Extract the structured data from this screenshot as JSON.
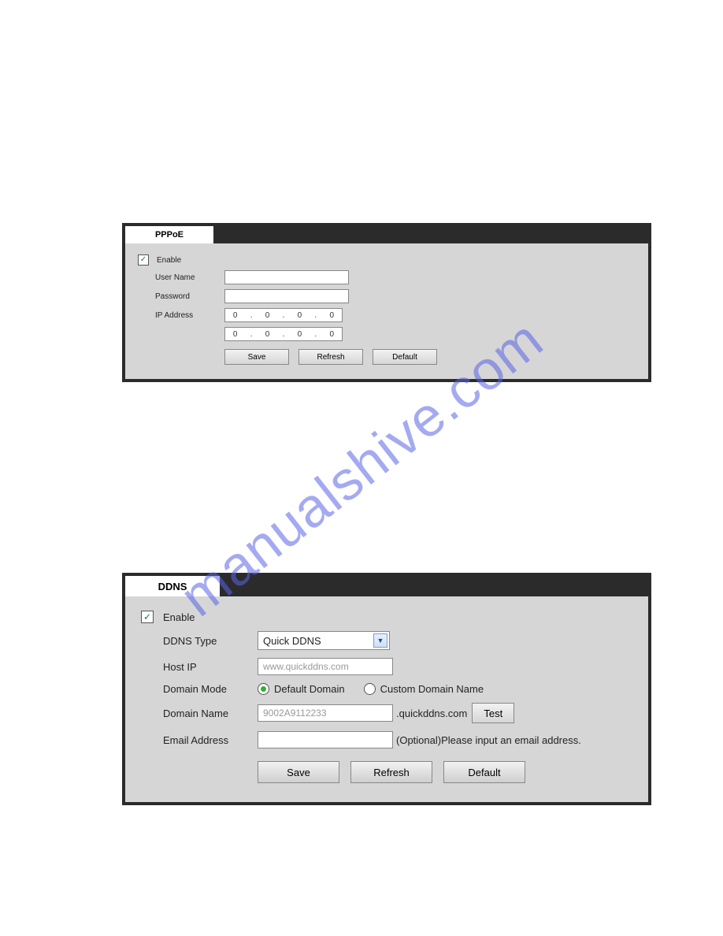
{
  "watermark": "manualshive.com",
  "pppoe": {
    "tab_label": "PPPoE",
    "enable_label": "Enable",
    "enable_checked": "✓",
    "username_label": "User Name",
    "username_value": "",
    "password_label": "Password",
    "password_value": "",
    "ipaddress_label": "IP Address",
    "ip1": {
      "a": "0",
      "b": "0",
      "c": "0",
      "d": "0"
    },
    "ip2": {
      "a": "0",
      "b": "0",
      "c": "0",
      "d": "0"
    },
    "save_btn": "Save",
    "refresh_btn": "Refresh",
    "default_btn": "Default"
  },
  "ddns": {
    "tab_label": "DDNS",
    "enable_label": "Enable",
    "enable_checked": "✓",
    "type_label": "DDNS Type",
    "type_value": "Quick DDNS",
    "hostip_label": "Host IP",
    "hostip_value": "www.quickddns.com",
    "domainmode_label": "Domain Mode",
    "mode_default_label": "Default Domain",
    "mode_custom_label": "Custom Domain Name",
    "domainname_label": "Domain Name",
    "domainname_value": "9002A9112233",
    "domain_suffix": ".quickddns.com",
    "test_btn": "Test",
    "email_label": "Email Address",
    "email_value": "",
    "email_hint": "(Optional)Please input an email address.",
    "save_btn": "Save",
    "refresh_btn": "Refresh",
    "default_btn": "Default"
  }
}
